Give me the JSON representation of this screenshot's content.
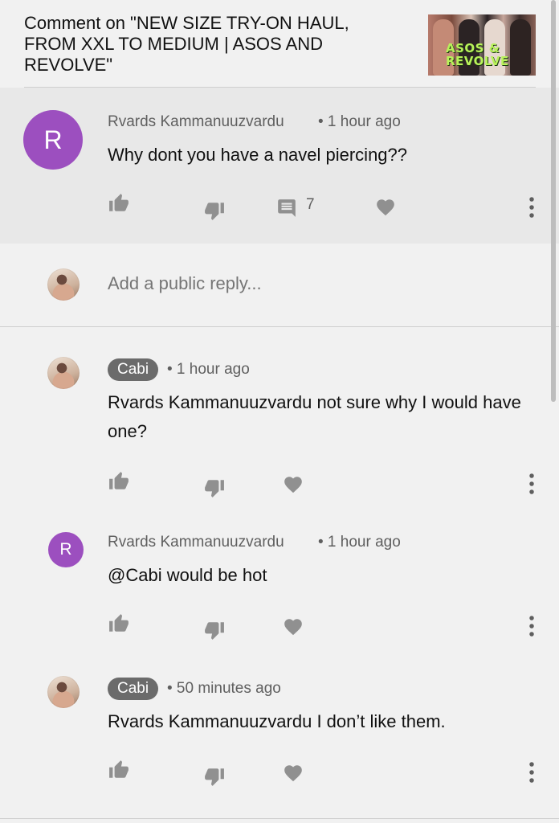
{
  "header": {
    "title": "Comment on \"NEW SIZE TRY-ON HAUL, FROM XXL TO MEDIUM | ASOS AND REVOLVE\"",
    "thumbnail_text": "ASOS & REVOLVE"
  },
  "main_comment": {
    "avatar_letter": "R",
    "author": "Rvards Kammanuuzvardu",
    "time": "• 1 hour ago",
    "text": "Why dont you have a navel piercing??",
    "reply_count": "7"
  },
  "reply_box": {
    "placeholder": "Add a public reply..."
  },
  "replies": [
    {
      "author": "Cabi",
      "time": "• 1 hour ago",
      "text": "Rvards Kammanuuzvardu not sure why I would have one?"
    },
    {
      "avatar_letter": "R",
      "author": "Rvards Kammanuuzvardu",
      "time": "• 1 hour ago",
      "text": "@Cabi would be hot"
    },
    {
      "author": "Cabi",
      "time": "• 50 minutes ago",
      "text": "Rvards Kammanuuzvardu I don’t like them."
    }
  ],
  "icons": {
    "like": "thumbs-up-icon",
    "dislike": "thumbs-down-icon",
    "replies": "comment-icon",
    "heart": "heart-icon",
    "more": "more-vert-icon"
  },
  "colors": {
    "background": "#f1f1f1",
    "main_comment_bg": "#e8e8e8",
    "avatar_purple": "#9c4fbf",
    "author_chip": "#6b6b6b",
    "icon_grey": "#909090"
  }
}
